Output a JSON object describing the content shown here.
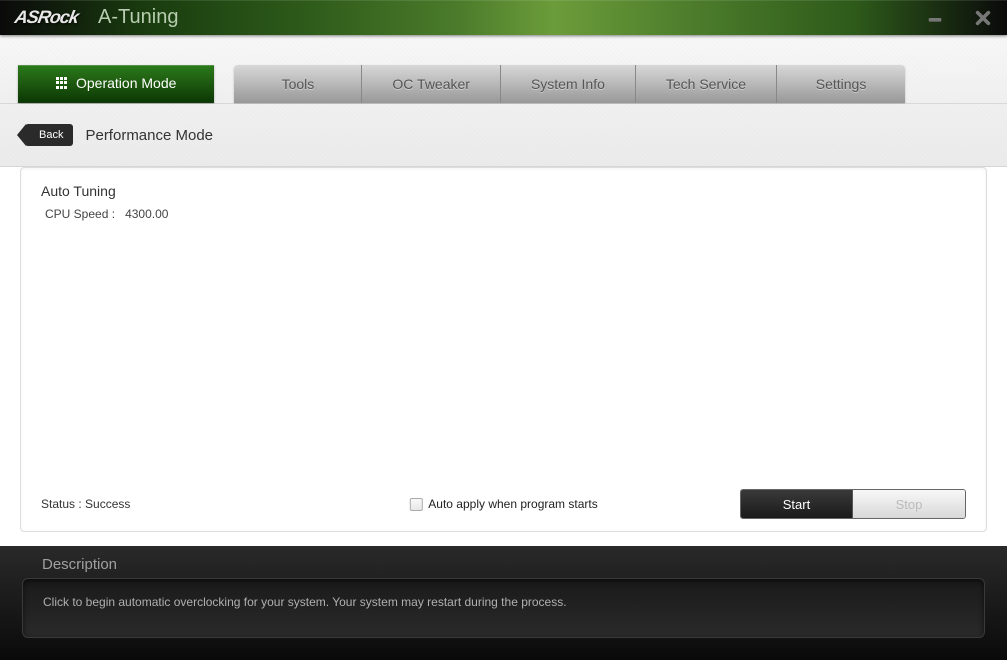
{
  "brand": "ASRock",
  "app_title": "A-Tuning",
  "tabs": {
    "active": "Operation Mode",
    "items": [
      "Tools",
      "OC Tweaker",
      "System Info",
      "Tech Service",
      "Settings"
    ]
  },
  "back_label": "Back",
  "page_title": "Performance Mode",
  "section_title": "Auto Tuning",
  "cpu_speed_label": "CPU Speed :",
  "cpu_speed_value": "4300.00",
  "status_label": "Status :",
  "status_value": "Success",
  "auto_apply_label": "Auto apply when program starts",
  "start_label": "Start",
  "stop_label": "Stop",
  "description_heading": "Description",
  "description_text": "Click to begin automatic overclocking for your system. Your system may restart during the process."
}
